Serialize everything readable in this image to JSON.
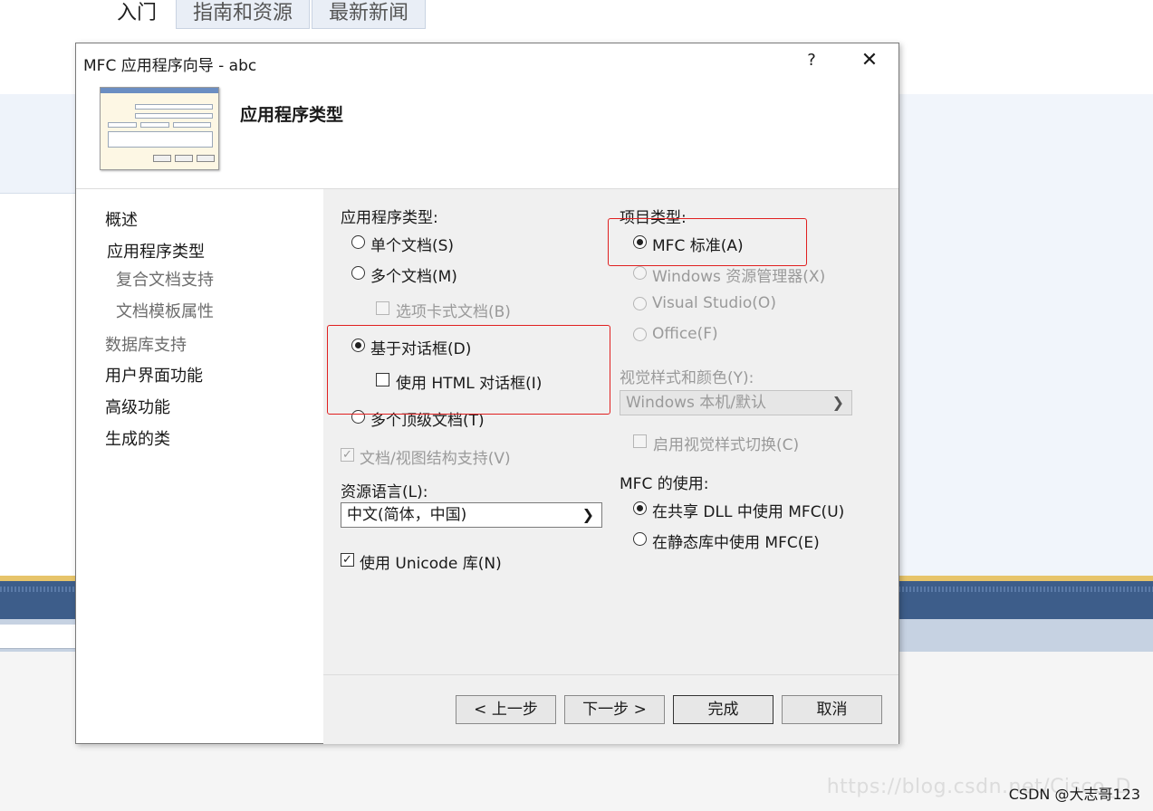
{
  "background": {
    "tabs": [
      "入门",
      "指南和资源",
      "最新新闻"
    ],
    "watermark_ghost": "https://blog.csdn.net/Cisco_D",
    "watermark": "CSDN @大志哥123"
  },
  "dialog": {
    "title": "MFC 应用程序向导 - abc",
    "help": "?",
    "close": "✕",
    "header_title": "应用程序类型"
  },
  "sidebar": {
    "items": [
      "概述",
      "应用程序类型",
      "复合文档支持",
      "文档模板属性",
      "数据库支持",
      "用户界面功能",
      "高级功能",
      "生成的类"
    ]
  },
  "app_type": {
    "label": "应用程序类型:",
    "single": "单个文档(S)",
    "multiple": "多个文档(M)",
    "tabbed": "选项卡式文档(B)",
    "dialog_based": "基于对话框(D)",
    "html_dialog": "使用 HTML 对话框(I)",
    "multiple_top": "多个顶级文档(T)",
    "doc_view": "文档/视图结构支持(V)"
  },
  "resource": {
    "label": "资源语言(L):",
    "value": "中文(简体，中国)",
    "unicode": "使用 Unicode 库(N)"
  },
  "project_type": {
    "label": "项目类型:",
    "mfc_standard": "MFC 标准(A)",
    "explorer": "Windows 资源管理器(X)",
    "visual_studio": "Visual Studio(O)",
    "office": "Office(F)"
  },
  "visual_style": {
    "label": "视觉样式和颜色(Y):",
    "value": "Windows 本机/默认",
    "switch": "启用视觉样式切换(C)"
  },
  "mfc_use": {
    "label": "MFC 的使用:",
    "shared": "在共享 DLL 中使用 MFC(U)",
    "static": "在静态库中使用 MFC(E)"
  },
  "footer": {
    "prev": "< 上一步",
    "next": "下一步 >",
    "finish": "完成",
    "cancel": "取消"
  },
  "icons": {
    "chevron": "chevron-down-icon",
    "check": "check-icon",
    "close": "close-icon"
  }
}
